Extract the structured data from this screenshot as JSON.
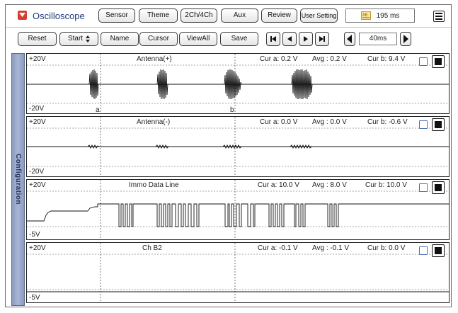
{
  "app": {
    "title": "Oscilloscope"
  },
  "toolbar_top": {
    "sensor": "Sensor",
    "theme": "Theme",
    "channels": "2Ch/4Ch",
    "aux": "Aux",
    "review": "Review",
    "user_setting": "User Setting",
    "time_value": "195 ms"
  },
  "toolbar_bottom": {
    "reset": "Reset",
    "start": "Start",
    "name": "Name",
    "cursor": "Cursor",
    "view_all": "ViewAll",
    "save": "Save",
    "timebase": "40ms"
  },
  "sidebar": {
    "configuration": "Configuration"
  },
  "channels": [
    {
      "name": "Antenna(+)",
      "top": "+20V",
      "bottom": "-20V",
      "cur_a": "Cur a: 0.2 V",
      "avg": "Avg : 0.2 V",
      "cur_b": "Cur b: 9.4 V",
      "cursor_a": "a",
      "cursor_b": "b"
    },
    {
      "name": "Antenna(-)",
      "top": "+20V",
      "bottom": "-20V",
      "cur_a": "Cur a: 0.0 V",
      "avg": "Avg : 0.0 V",
      "cur_b": "Cur b: -0.6 V"
    },
    {
      "name": "Immo Data Line",
      "top": "+20V",
      "bottom": "-5V",
      "cur_a": "Cur a: 10.0 V",
      "avg": "Avg : 8.0 V",
      "cur_b": "Cur b: 10.0 V"
    },
    {
      "name": "Ch B2",
      "top": "+20V",
      "bottom": "-5V",
      "cur_a": "Cur a: -0.1 V",
      "avg": "Avg : -0.1 V",
      "cur_b": "Cur b: 0.0 V"
    }
  ],
  "icons": {
    "app": "oscilloscope-app-icon",
    "time": "ab-time-icon",
    "menu": "hamburger-menu-icon",
    "first": "skip-to-start-icon",
    "prev": "previous-icon",
    "next": "next-icon",
    "last": "skip-to-end-icon",
    "decrease": "timebase-decrease-icon",
    "increase": "timebase-increase-icon"
  },
  "colors": {
    "title": "#1e3a80",
    "app_icon": "#d44030",
    "sidebar": "#a9b6d3",
    "trace": "#111111"
  }
}
